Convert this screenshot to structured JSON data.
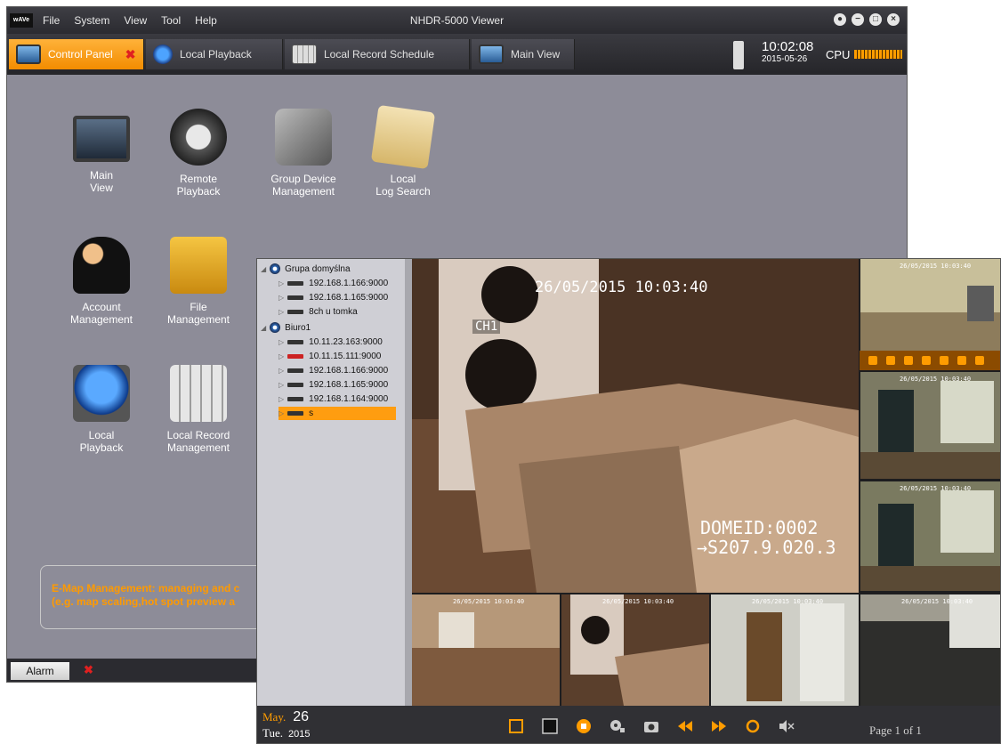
{
  "app": {
    "title": "NHDR-5000 Viewer",
    "logo": "wAVe",
    "menu": [
      "File",
      "System",
      "View",
      "Tool",
      "Help"
    ]
  },
  "tabs": [
    {
      "label": "Control Panel",
      "active": true,
      "icon": "monitor-icon"
    },
    {
      "label": "Local Playback",
      "active": false,
      "icon": "playback-icon"
    },
    {
      "label": "Local Record Schedule",
      "active": false,
      "icon": "calendar-icon"
    },
    {
      "label": "Main View",
      "active": false,
      "icon": "monitor-icon"
    }
  ],
  "status": {
    "time": "10:02:08",
    "date": "2015-05-26",
    "cpu_label": "CPU"
  },
  "control_panel": {
    "items": [
      {
        "label1": "Main",
        "label2": "View"
      },
      {
        "label1": "Remote",
        "label2": "Playback"
      },
      {
        "label1": "Group Device",
        "label2": "Management"
      },
      {
        "label1": "Local",
        "label2": "Log Search"
      },
      {
        "label1": "Account",
        "label2": "Management"
      },
      {
        "label1": "File",
        "label2": "Management"
      },
      {
        "label1": "Local",
        "label2": "Playback"
      },
      {
        "label1": "Local Record",
        "label2": "Management"
      }
    ],
    "emap_line1": "E-Map Management: managing and c",
    "emap_line2": "(e.g. map scaling,hot spot preview a"
  },
  "footer": {
    "alarm": "Alarm"
  },
  "tree": {
    "groups": [
      {
        "name": "Grupa domyślna",
        "devices": [
          "192.168.1.166:9000",
          "192.168.1.165:9000",
          "8ch u tomka"
        ]
      },
      {
        "name": "Biuro1",
        "devices": [
          "10.11.23.163:9000",
          "10.11.15.111:9000",
          "192.168.1.166:9000",
          "192.168.1.165:9000",
          "192.168.1.164:9000",
          "s"
        ]
      }
    ]
  },
  "video": {
    "main_timestamp": "26/05/2015 10:03:40",
    "channel": "CH1",
    "dome_id": "DOMEID:0002",
    "dome_pos": "→S207.9.020.3",
    "thumb_timestamp": "26/05/2015 10:03:40"
  },
  "playback": {
    "month": "May.",
    "day": "26",
    "weekday": "Tue.",
    "year": "2015",
    "page": "Page 1 of 1"
  }
}
